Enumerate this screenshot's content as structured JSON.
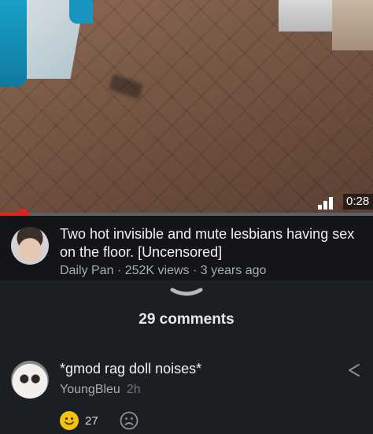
{
  "video": {
    "duration": "0:28",
    "progress": 0.05
  },
  "info": {
    "title": "Two hot invisible and mute lesbians having sex on the floor. [Uncensored]",
    "channel": "Daily Pan",
    "views": "252K views",
    "age": "3 years ago",
    "separator": "·"
  },
  "comments": {
    "count_label": "29 comments",
    "items": [
      {
        "text": "*gmod rag doll noises*",
        "author": "YoungBleu",
        "time": "2h",
        "likes": "27"
      }
    ]
  },
  "colors": {
    "progress": "#e62117",
    "background": "#1b1e23",
    "like_emoji": "#f3c20c"
  },
  "icons": [
    "signal-bars-icon",
    "chevron-down-icon",
    "share-icon",
    "smile-emoji-icon",
    "frown-emoji-icon"
  ]
}
